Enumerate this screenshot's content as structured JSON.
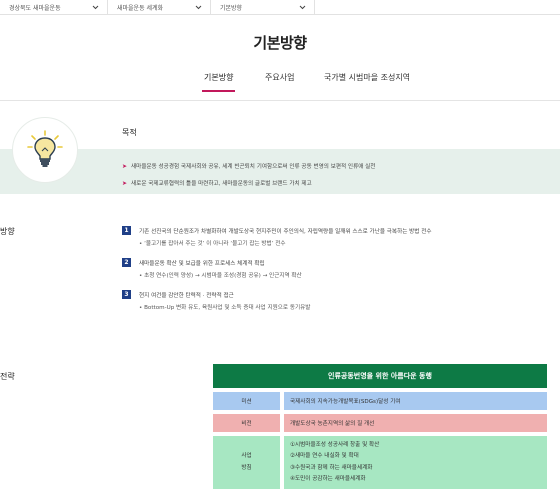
{
  "breadcrumb": {
    "items": [
      "경상북도 새마을운동",
      "새마을운동 세계화",
      "기본방향"
    ]
  },
  "page": {
    "title": "기본방향"
  },
  "tabs": [
    {
      "label": "기본방향",
      "active": true
    },
    {
      "label": "주요사업",
      "active": false
    },
    {
      "label": "국가별 시범마을 조성지역",
      "active": false
    }
  ],
  "purpose": {
    "label": "목적",
    "icon": "lightbulb-icon",
    "items": [
      "새마을운동 성공경험 국제사회와 공유, 세계 빈곤퇴치 기여함으로써 인류 공동 번영의 보편적 인류애 실천",
      "새로운 국제교류협력의 틀을 마련하고, 새마을운동의 글로벌 브랜드 가치 제고"
    ]
  },
  "directions": {
    "label": "방향",
    "items": [
      {
        "num": "1",
        "text": "기존 선진국의 단순원조가 차별화하여 개발도상국 현지주민이 주인의식, 자립역량을 일깨워 스스로 가난을 극복하는 방법 전수",
        "sub": "• ‘물고기를 잡아서 주는 것’ 이 아니라 ‘물고기 잡는 방법’ 전수"
      },
      {
        "num": "2",
        "text": "새마을운동 확산 및 보급을 위한 프로세스 체계적 확립",
        "sub": "• 초청 연수(인력 양성) → 시범마을 조성(경험 공유) → 인근지역 확산"
      },
      {
        "num": "3",
        "text": "현지 여건을 감안한 탄력적 · 전략적 접근",
        "sub": "• Bottom-Up 변화 유도, 육원사업 및 소득 증대 사업 지원으로 동기유발"
      }
    ]
  },
  "strategy": {
    "label": "전략",
    "banner": "인류공동번영을 위한 아름다운 동행",
    "mission_label": "미션",
    "mission_text": "국제사회의 지속가능개발목표(SDGs)달성 기여",
    "vision_label": "비전",
    "vision_text": "개발도상국 농촌지역의 삶의 질 개선",
    "plan_label_1": "사업",
    "plan_label_2": "방침",
    "plan_items": [
      "①시범마을조성 성공사례 창출 및 확산",
      "②새마을 연수 내실화 및 확대",
      "③수원국과 함께 하는 새마을세계화",
      "④도민이 공감하는 새마을세계화"
    ]
  },
  "colors": {
    "accent": "#c2185b",
    "banner": "#0d7a45",
    "number_badge": "#1f3f87",
    "mission": "#a8c9f0",
    "vision": "#f0b0b0",
    "plan": "#a7e7c2",
    "band": "#e6f0eb"
  }
}
